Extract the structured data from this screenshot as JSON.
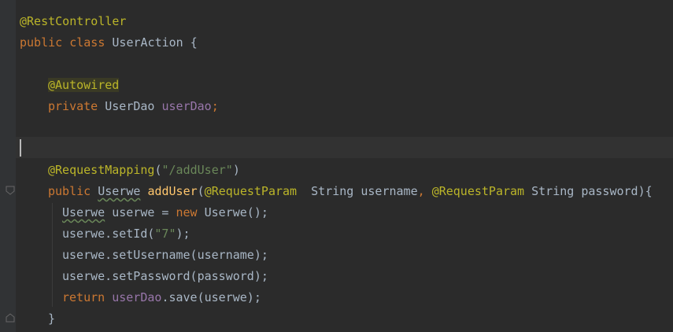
{
  "colors": {
    "background": "#2b2b2b",
    "gutter": "#313335",
    "annotation": "#bbb529",
    "keyword": "#cc7832",
    "field": "#9876aa",
    "string": "#6a8759",
    "method_decl": "#ffc66d",
    "text": "#a9b7c6"
  },
  "code": {
    "l1": "@RestController",
    "l2_kw": "public class ",
    "l2_name": "UserAction {",
    "l4_ann": "@Autowired",
    "l5_kw": "private ",
    "l5_type": "UserDao ",
    "l5_field": "userDao",
    "l5_semi": ";",
    "l8_ann": "@RequestMapping",
    "l8_open": "(",
    "l8_str": "\"/addUser\"",
    "l8_close": ")",
    "l9_kw": "public ",
    "l9_type": "Userwe",
    "l9_method": "addUser",
    "l9_paren": "(",
    "l9_ann1": "@RequestParam",
    "l9_p1": "  String username",
    "l9_comma": ", ",
    "l9_ann2": "@RequestParam",
    "l9_p2": " String password){",
    "l10_type": "Userwe",
    "l10_a": " userwe = ",
    "l10_kw": "new ",
    "l10_b": "Userwe();",
    "l11_a": "userwe.setId(",
    "l11_str": "\"7\"",
    "l11_b": ");",
    "l12": "userwe.setUsername(username);",
    "l13": "userwe.setPassword(password);",
    "l14_kw": "return ",
    "l14_field": "userDao",
    "l14_b": ".save(userwe);",
    "l15": "}"
  }
}
